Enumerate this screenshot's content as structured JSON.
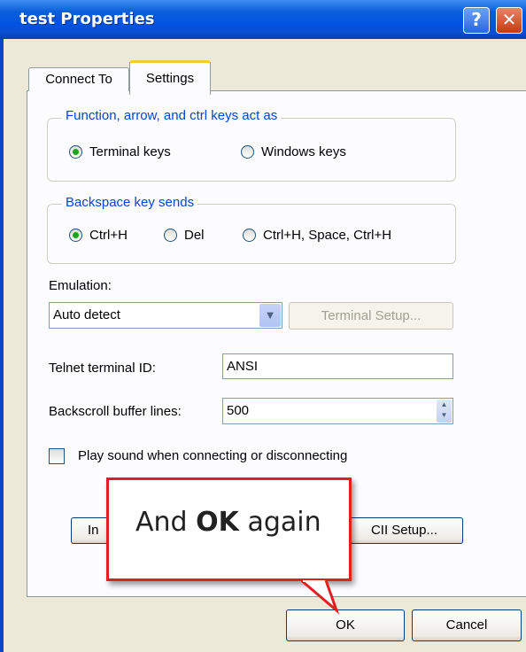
{
  "window": {
    "title": "test Properties"
  },
  "titlebar": {
    "help": "?",
    "close": "✕"
  },
  "tabs": [
    {
      "label": "Connect To"
    },
    {
      "label": "Settings"
    }
  ],
  "group_keys": {
    "legend": "Function, arrow, and ctrl keys act as",
    "options": [
      {
        "label": "Terminal keys",
        "selected": true
      },
      {
        "label": "Windows keys",
        "selected": false
      }
    ]
  },
  "group_backspace": {
    "legend": "Backspace key sends",
    "options": [
      {
        "label": "Ctrl+H",
        "selected": true
      },
      {
        "label": "Del",
        "selected": false
      },
      {
        "label": "Ctrl+H, Space, Ctrl+H",
        "selected": false
      }
    ]
  },
  "emulation": {
    "label": "Emulation:",
    "value": "Auto detect",
    "setup_button": "Terminal Setup..."
  },
  "telnet": {
    "label": "Telnet terminal ID:",
    "value": "ANSI"
  },
  "backscroll": {
    "label": "Backscroll buffer lines:",
    "value": "500"
  },
  "sound": {
    "label": "Play sound when connecting or disconnecting",
    "checked": false
  },
  "bottom_buttons": {
    "left_partial": "In",
    "right_partial": "CII Setup..."
  },
  "callout": {
    "prefix": "And",
    "bold": "OK",
    "suffix": "again"
  },
  "dialog_buttons": {
    "ok": "OK",
    "cancel": "Cancel"
  },
  "colors": {
    "accent_tab": "#ffc83c",
    "legend_blue": "#0046d5",
    "callout_red": "#e02020",
    "titlebar_blue": "#0054e3"
  }
}
